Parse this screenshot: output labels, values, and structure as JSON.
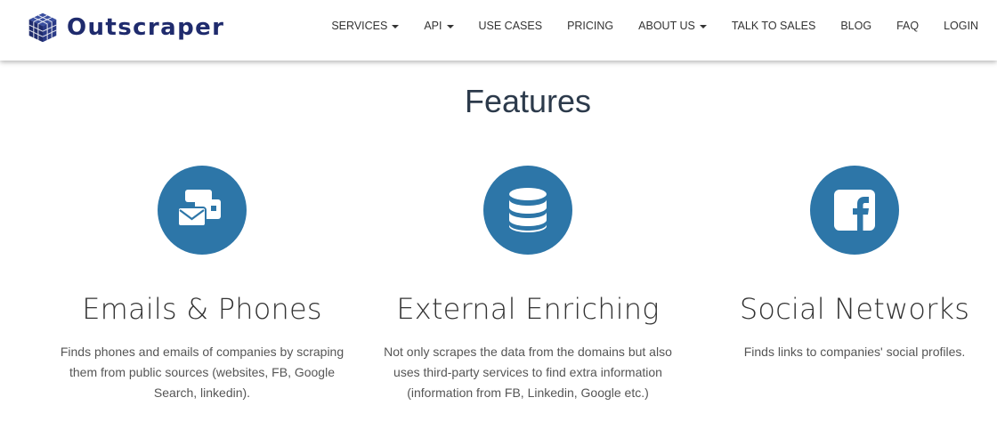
{
  "brand": {
    "name": "Outscraper",
    "color": "#1f2b6d"
  },
  "nav": {
    "items": [
      {
        "label": "SERVICES",
        "dropdown": true
      },
      {
        "label": "API",
        "dropdown": true
      },
      {
        "label": "USE CASES",
        "dropdown": false
      },
      {
        "label": "PRICING",
        "dropdown": false
      },
      {
        "label": "ABOUT US",
        "dropdown": true
      },
      {
        "label": "TALK TO SALES",
        "dropdown": false
      },
      {
        "label": "BLOG",
        "dropdown": false
      },
      {
        "label": "FAQ",
        "dropdown": false
      },
      {
        "label": "LOGIN",
        "dropdown": false
      }
    ]
  },
  "features": {
    "heading": "Features",
    "accent_color": "#2d76a8",
    "items": [
      {
        "icon": "envelope-card-icon",
        "title": "Emails & Phones",
        "description": "Finds phones and emails of companies by scraping them from public sources (websites, FB, Google Search, linkedin)."
      },
      {
        "icon": "database-icon",
        "title": "External Enriching",
        "description": "Not only scrapes the data from the domains but also uses third-party services to find extra information (information from FB, Linkedin, Google etc.)"
      },
      {
        "icon": "facebook-icon",
        "title": "Social Networks",
        "description": "Finds links to companies' social profiles."
      }
    ]
  }
}
